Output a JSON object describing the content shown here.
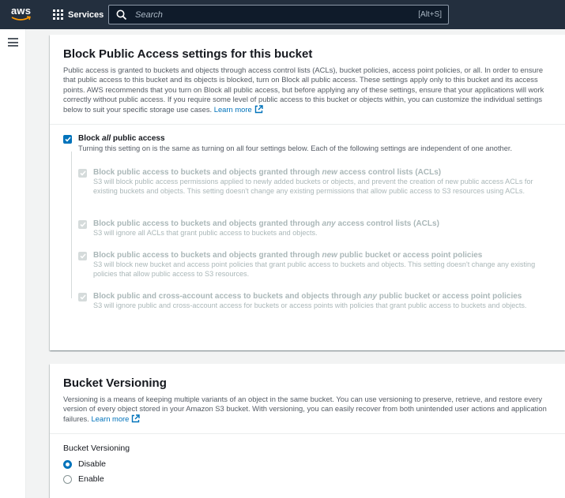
{
  "nav": {
    "logo_text": "aws",
    "services_label": "Services",
    "search_placeholder": "Search",
    "search_shortcut": "[Alt+S]"
  },
  "block_public_access": {
    "title": "Block Public Access settings for this bucket",
    "description": "Public access is granted to buckets and objects through access control lists (ACLs), bucket policies, access point policies, or all. In order to ensure that public access to this bucket and its objects is blocked, turn on Block all public access. These settings apply only to this bucket and its access points. AWS recommends that you turn on Block all public access, but before applying any of these settings, ensure that your applications will work correctly without public access. If you require some level of public access to this bucket or objects within, you can customize the individual settings below to suit your specific storage use cases.",
    "learn_more": "Learn more",
    "block_all": {
      "label_pre": "Block ",
      "label_em": "all",
      "label_post": " public access",
      "description": "Turning this setting on is the same as turning on all four settings below. Each of the following settings are independent of one another.",
      "checked": true
    },
    "settings": [
      {
        "title_pre": "Block public access to buckets and objects granted through ",
        "title_em": "new",
        "title_post": " access control lists (ACLs)",
        "description": "S3 will block public access permissions applied to newly added buckets or objects, and prevent the creation of new public access ACLs for existing buckets and objects. This setting doesn't change any existing permissions that allow public access to S3 resources using ACLs."
      },
      {
        "title_pre": "Block public access to buckets and objects granted through ",
        "title_em": "any",
        "title_post": " access control lists (ACLs)",
        "description": "S3 will ignore all ACLs that grant public access to buckets and objects."
      },
      {
        "title_pre": "Block public access to buckets and objects granted through ",
        "title_em": "new",
        "title_post": " public bucket or access point policies",
        "description": "S3 will block new bucket and access point policies that grant public access to buckets and objects. This setting doesn't change any existing policies that allow public access to S3 resources."
      },
      {
        "title_pre": "Block public and cross-account access to buckets and objects through ",
        "title_em": "any",
        "title_post": " public bucket or access point policies",
        "description": "S3 will ignore public and cross-account access for buckets or access points with policies that grant public access to buckets and objects."
      }
    ]
  },
  "bucket_versioning": {
    "title": "Bucket Versioning",
    "description": "Versioning is a means of keeping multiple variants of an object in the same bucket. You can use versioning to preserve, retrieve, and restore every version of every object stored in your Amazon S3 bucket. With versioning, you can easily recover from both unintended user actions and application failures.",
    "learn_more": "Learn more",
    "field_label": "Bucket Versioning",
    "options": [
      "Disable",
      "Enable"
    ],
    "selected": "Disable"
  }
}
